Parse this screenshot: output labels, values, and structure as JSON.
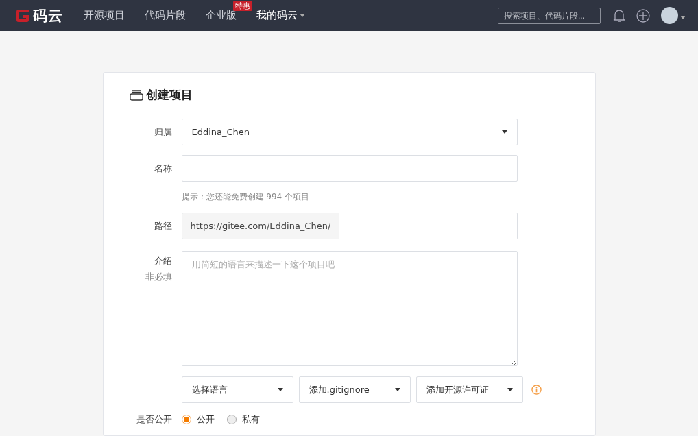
{
  "navbar": {
    "logo_text": "码云",
    "links": [
      {
        "label": "开源项目",
        "selected": false
      },
      {
        "label": "代码片段",
        "selected": false
      },
      {
        "label": "企业版",
        "selected": false,
        "badge": "特惠"
      },
      {
        "label": "我的码云",
        "selected": true,
        "dropdown": true
      }
    ],
    "search": {
      "placeholder": "搜索项目、代码片段..."
    }
  },
  "form": {
    "title": "创建项目",
    "owner": {
      "label": "归属",
      "value": "Eddina_Chen"
    },
    "name": {
      "label": "名称",
      "hint": "提示：您还能免费创建 994 个项目"
    },
    "path": {
      "label": "路径",
      "prefix": "https://gitee.com/Eddina_Chen/"
    },
    "description": {
      "label": "介绍",
      "sublabel": "非必填",
      "placeholder": "用简短的语言来描述一下这个项目吧"
    },
    "selects": [
      "选择语言",
      "添加.gitignore",
      "添加开源许可证"
    ],
    "visibility": {
      "label": "是否公开",
      "options": [
        {
          "label": "公开",
          "selected": true
        },
        {
          "label": "私有",
          "selected": false
        }
      ]
    }
  }
}
